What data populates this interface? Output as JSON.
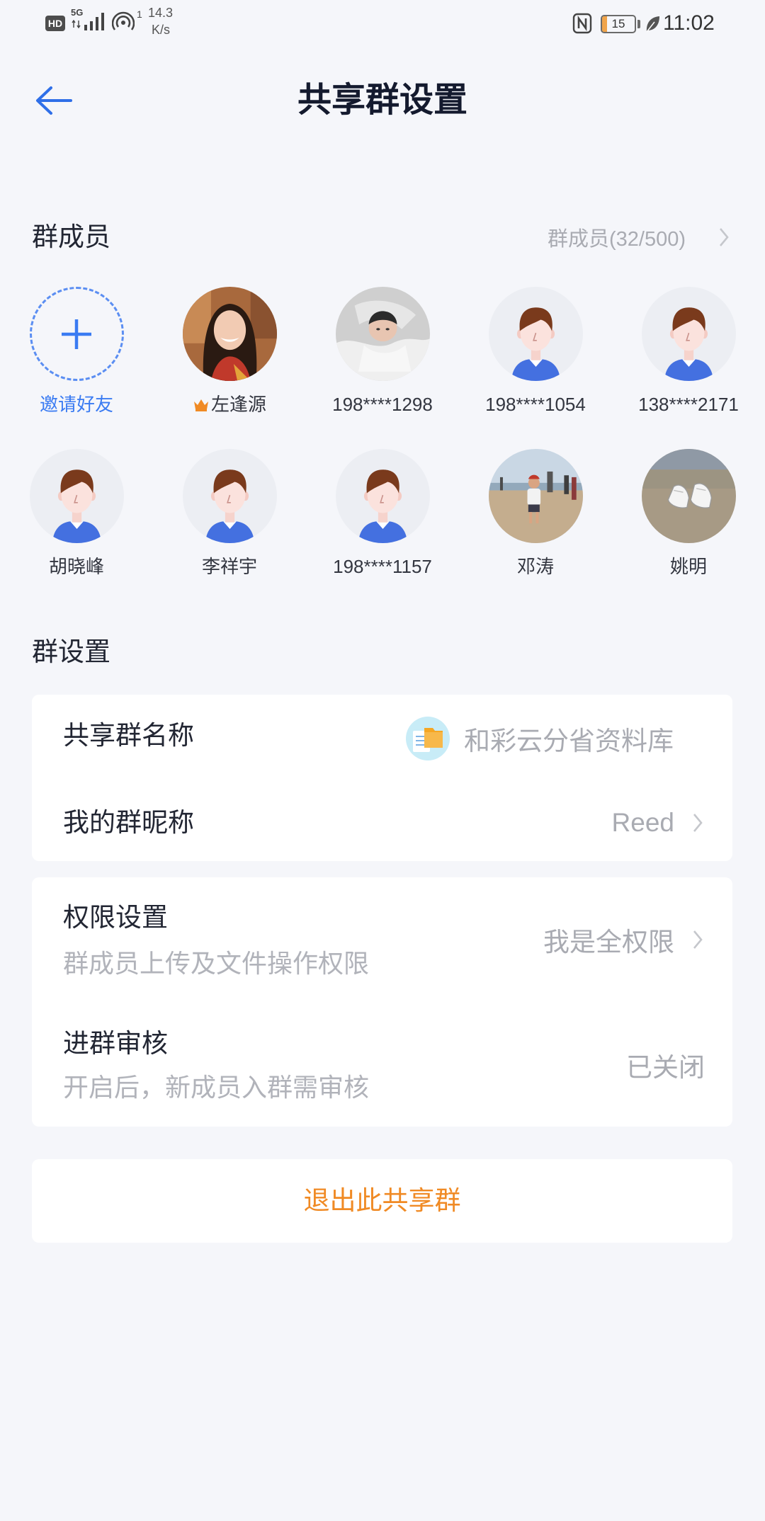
{
  "status_bar": {
    "hd_badge": "HD",
    "network_type": "5G",
    "hotspot_connections": "1",
    "net_speed_value": "14.3",
    "net_speed_unit": "K/s",
    "battery_level": "15",
    "time": "11:02",
    "icons": [
      "hd-icon",
      "signal-icon",
      "hotspot-icon",
      "nfc-icon",
      "battery-icon",
      "power-saving-leaf-icon"
    ]
  },
  "header": {
    "back_icon": "back-arrow-icon",
    "title": "共享群设置"
  },
  "members": {
    "section_title": "群成员",
    "count_label": "群成员(32/500)",
    "invite": {
      "label": "邀请好友",
      "icon": "plus-icon"
    },
    "owner_badge_icon": "crown-icon",
    "list": [
      {
        "name": "左逢源"
      },
      {
        "name": "198****1298"
      },
      {
        "name": "198****1054"
      },
      {
        "name": "138****2171"
      },
      {
        "name": "胡晓峰"
      },
      {
        "name": "李祥宇"
      },
      {
        "name": "198****1157"
      },
      {
        "name": "邓涛"
      },
      {
        "name": "姚明"
      }
    ]
  },
  "settings": {
    "section_title": "群设置",
    "group_name": {
      "label": "共享群名称",
      "value": "和彩云分省资料库",
      "icon": "group-folder-icon"
    },
    "nickname": {
      "label": "我的群昵称",
      "value": "Reed"
    },
    "permissions": {
      "label": "权限设置",
      "description": "群成员上传及文件操作权限",
      "value": "我是全权限"
    },
    "join_review": {
      "label": "进群审核",
      "description": "开启后，新成员入群需审核",
      "value": "已关闭"
    }
  },
  "exit_button": {
    "label": "退出此共享群"
  },
  "colors": {
    "accent_blue": "#3a7bf2",
    "exit_orange": "#f08a24",
    "background": "#f5f6fa",
    "card": "#ffffff",
    "secondary_text": "#a9abb2"
  }
}
